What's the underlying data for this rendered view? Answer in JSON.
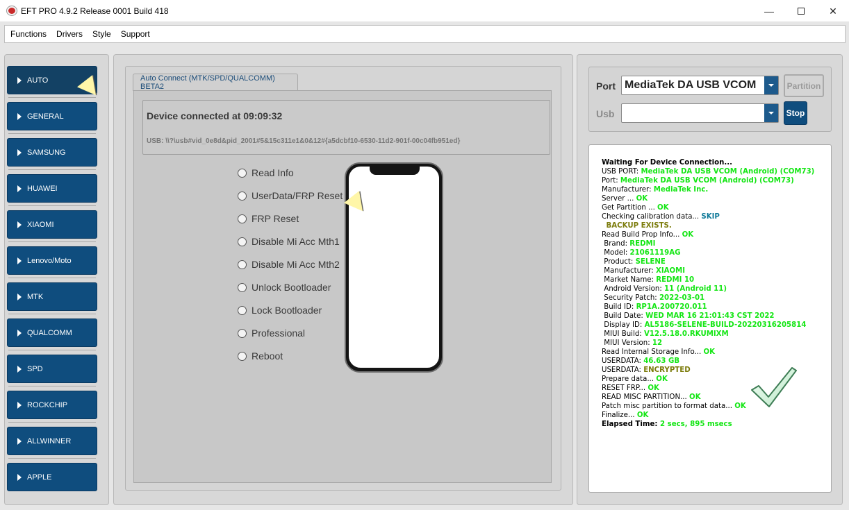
{
  "window": {
    "title": "EFT PRO 4.9.2 Release 0001 Build 418",
    "minimize": "—",
    "close": "✕"
  },
  "menu": [
    "Functions",
    "Drivers",
    "Style",
    "Support"
  ],
  "sidebar": {
    "items": [
      {
        "label": "AUTO",
        "active": true
      },
      {
        "label": "GENERAL"
      },
      {
        "label": "SAMSUNG"
      },
      {
        "label": "HUAWEI"
      },
      {
        "label": "XIAOMI"
      },
      {
        "label": "Lenovo/Moto"
      },
      {
        "label": "MTK"
      },
      {
        "label": "QUALCOMM"
      },
      {
        "label": "SPD"
      },
      {
        "label": "ROCKCHIP"
      },
      {
        "label": "ALLWINNER"
      },
      {
        "label": "APPLE"
      }
    ]
  },
  "center": {
    "tab_label": "Auto Connect (MTK/SPD/QUALCOMM) BETA2",
    "device_title": "Device connected at 09:09:32",
    "device_usb": "USB: \\\\?\\usb#vid_0e8d&pid_2001#5&15c311e1&0&12#{a5dcbf10-6530-11d2-901f-00c04fb951ed}",
    "options": [
      "Read Info",
      "UserData/FRP Reset",
      "FRP Reset",
      "Disable Mi Acc Mth1",
      "Disable Mi Acc Mth2",
      "Unlock Bootloader",
      "Lock Bootloader",
      "Professional",
      "Reboot"
    ]
  },
  "right": {
    "port_label": "Port",
    "port_value": "MediaTek DA USB VCOM",
    "usb_label": "Usb",
    "usb_value": "",
    "partition_button": "Partition",
    "stop_button": "Stop"
  },
  "log": [
    {
      "k": "Waiting For Device Connection...",
      "v": "",
      "c": "black",
      "bold_key": true
    },
    {
      "k": "USB PORT: ",
      "v": "MediaTek DA USB VCOM (Android) (COM73)",
      "c": "green"
    },
    {
      "k": "Port: ",
      "v": "MediaTek DA USB VCOM (Android) (COM73)",
      "c": "green"
    },
    {
      "k": "Manufacturer: ",
      "v": "MediaTek Inc.",
      "c": "green"
    },
    {
      "k": "Server ... ",
      "v": "OK",
      "c": "green"
    },
    {
      "k": "Get Partition ... ",
      "v": "OK",
      "c": "green"
    },
    {
      "k": "Checking calibration data... ",
      "v": "SKIP",
      "c": "teal"
    },
    {
      "k": "  ",
      "v": "BACKUP EXISTS.",
      "c": "olive"
    },
    {
      "k": "Read Build Prop Info... ",
      "v": "OK",
      "c": "green"
    },
    {
      "k": " Brand: ",
      "v": "REDMI",
      "c": "green"
    },
    {
      "k": " Model: ",
      "v": "21061119AG",
      "c": "green"
    },
    {
      "k": " Product: ",
      "v": "SELENE",
      "c": "green"
    },
    {
      "k": " Manufacturer: ",
      "v": "XIAOMI",
      "c": "green"
    },
    {
      "k": " Market Name: ",
      "v": "REDMI 10",
      "c": "green"
    },
    {
      "k": " Android Version: ",
      "v": "11 (Android 11)",
      "c": "green"
    },
    {
      "k": " Security Patch: ",
      "v": "2022-03-01",
      "c": "green"
    },
    {
      "k": " Build ID: ",
      "v": "RP1A.200720.011",
      "c": "green"
    },
    {
      "k": " Build Date: ",
      "v": "WED MAR 16 21:01:43 CST 2022",
      "c": "green"
    },
    {
      "k": " Display ID: ",
      "v": "AL5186-SELENE-BUILD-20220316205814",
      "c": "green"
    },
    {
      "k": " MIUI Build: ",
      "v": "V12.5.18.0.RKUMIXM",
      "c": "green"
    },
    {
      "k": " MIUI Version: ",
      "v": "12",
      "c": "green"
    },
    {
      "k": "Read Internal Storage Info... ",
      "v": "OK",
      "c": "green"
    },
    {
      "k": "USERDATA: ",
      "v": "46.63 GB",
      "c": "green"
    },
    {
      "k": "USERDATA: ",
      "v": "ENCRYPTED",
      "c": "olive"
    },
    {
      "k": "Prepare data... ",
      "v": "OK",
      "c": "green"
    },
    {
      "k": "RESET FRP... ",
      "v": "OK",
      "c": "green"
    },
    {
      "k": "READ MISC PARTITION... ",
      "v": "OK",
      "c": "green"
    },
    {
      "k": "Patch misc partition to format data... ",
      "v": "OK",
      "c": "green"
    },
    {
      "k": "Finalize... ",
      "v": "OK",
      "c": "green"
    },
    {
      "k": "Elapsed Time: ",
      "v": "2 secs, 895 msecs",
      "c": "green",
      "bold_key": true
    }
  ],
  "colors": {
    "sidebar_button": "#0f4d7e",
    "log_ok": "#14e614",
    "log_skip": "#0f7a99",
    "log_warn": "#7b7b0a"
  }
}
